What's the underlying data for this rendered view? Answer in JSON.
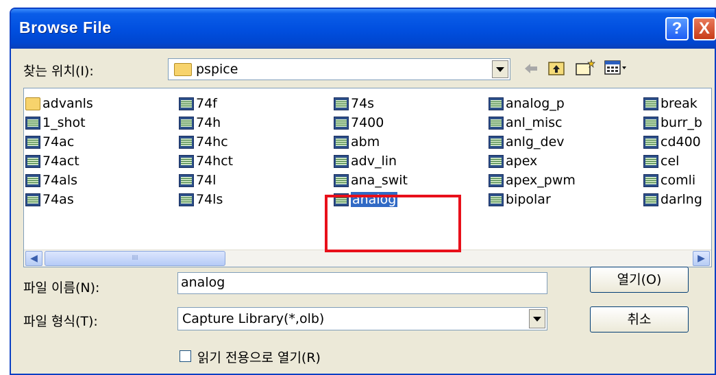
{
  "window": {
    "title": "Browse File",
    "help_label": "?",
    "close_label": "X"
  },
  "lookin": {
    "label": "찾는 위치(I):",
    "value": "pspice"
  },
  "toolbar": {
    "back_icon": "back-arrow-icon",
    "up_icon": "up-folder-icon",
    "new_folder_icon": "new-folder-icon",
    "view_menu_icon": "view-menu-icon"
  },
  "files": {
    "col1": [
      "advanls",
      "1_shot",
      "74ac",
      "74act",
      "74als",
      "74as"
    ],
    "col2": [
      "74f",
      "74h",
      "74hc",
      "74hct",
      "74l",
      "74ls"
    ],
    "col3": [
      "74s",
      "7400",
      "abm",
      "adv_lin",
      "ana_swit",
      "analog"
    ],
    "col4": [
      "analog_p",
      "anl_misc",
      "anlg_dev",
      "apex",
      "apex_pwm",
      "bipolar"
    ],
    "col5": [
      "break",
      "burr_b",
      "cd400",
      "cel",
      "comli",
      "darlng"
    ]
  },
  "filename": {
    "label": "파일 이름(N):",
    "value": "analog"
  },
  "filetype": {
    "label": "파일 형식(T):",
    "value": "Capture Library(*,olb)"
  },
  "buttons": {
    "open": "열기(O)",
    "cancel": "취소"
  },
  "readonly": {
    "label": "읽기 전용으로 열기(R)",
    "checked": false
  },
  "scrollbar": {
    "grip": "III"
  },
  "highlight_color": "#e8101a",
  "selection_color": "#316ac5"
}
